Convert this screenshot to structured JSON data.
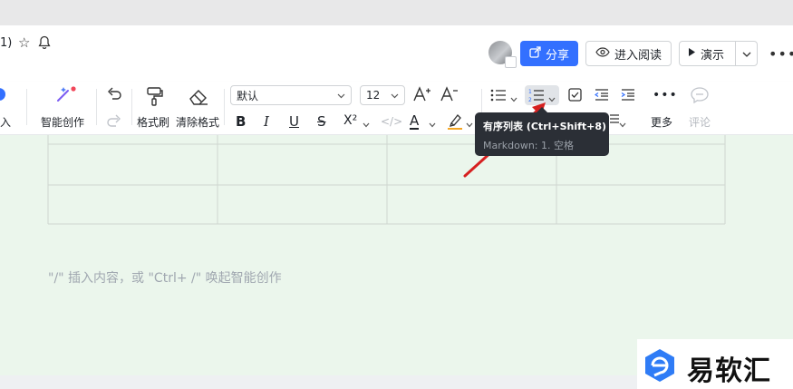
{
  "header": {
    "title_fragment": "1)",
    "share_label": "分享",
    "read_label": "进入阅读",
    "present_label": "演示"
  },
  "toolbar": {
    "ai_partial_label": "入",
    "ai_label": "智能创作",
    "format_brush_label": "格式刷",
    "clear_format_label": "清除格式",
    "font_value": "默认",
    "font_size_value": "12",
    "bold": "B",
    "italic": "I",
    "underline": "U",
    "strike": "S",
    "superscript": "X²",
    "code": "</>",
    "font_color": "A",
    "more_label": "更多",
    "comment_label": "评论"
  },
  "tooltip": {
    "title": "有序列表 (Ctrl+Shift+8)",
    "subtitle": "Markdown: 1. 空格"
  },
  "editor": {
    "placeholder": "\"/\" 插入内容，或 \"Ctrl+ /\" 唤起智能创作"
  },
  "watermark": {
    "text": "易软汇"
  },
  "colors": {
    "accent": "#3370ff",
    "editor_bg": "#ebf6ec",
    "tooltip_bg": "#2b2f36",
    "arrow": "#d62020"
  }
}
